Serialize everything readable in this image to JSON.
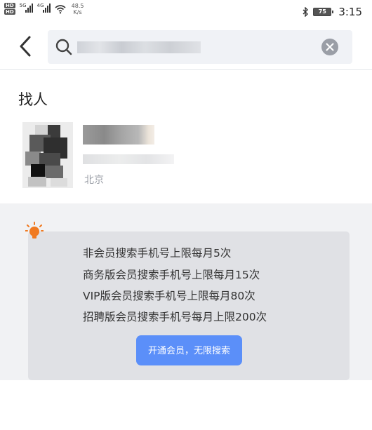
{
  "status_bar": {
    "hd_badges": [
      "HD",
      "HD"
    ],
    "network_types": [
      "5G",
      "4G"
    ],
    "speed_value": "48.5",
    "speed_unit": "K/s",
    "battery": "75",
    "time": "3:15",
    "icons": [
      "bluetooth-icon",
      "wifi-icon",
      "signal-icon",
      "battery-icon"
    ]
  },
  "header": {
    "back_icon": "chevron-left-icon",
    "search_icon": "search-icon",
    "clear_icon": "clear-circle-icon"
  },
  "section": {
    "title": "找人"
  },
  "result": {
    "location": "北京"
  },
  "promo": {
    "icon": "lightbulb-icon",
    "lines": [
      "非会员搜索手机号上限每月5次",
      "商务版会员搜索手机号上限每月15次",
      "VIP版会员搜索手机号上限每月80次",
      "招聘版会员搜索手机号每月上限200次"
    ],
    "cta_label": "开通会员，无限搜索"
  },
  "colors": {
    "accent": "#5b8ff9",
    "bulb": "#f07a21",
    "card": "#e0e1e5",
    "area": "#f1f2f4"
  }
}
